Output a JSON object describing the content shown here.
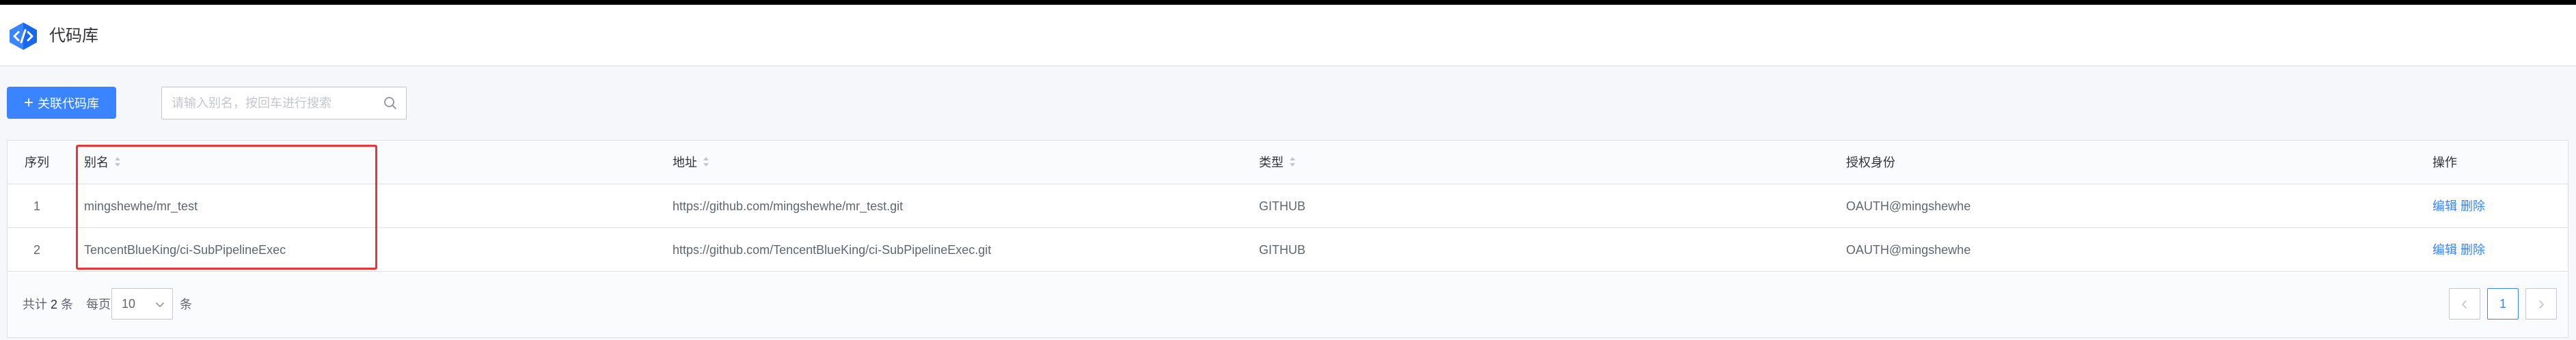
{
  "header": {
    "title": "代码库"
  },
  "toolbar": {
    "add_label": "关联代码库",
    "search_placeholder": "请输入别名，按回车进行搜索"
  },
  "table": {
    "columns": [
      "序列",
      "别名",
      "地址",
      "类型",
      "授权身份",
      "操作"
    ],
    "rows": [
      {
        "index": "1",
        "alias": "mingshewhe/mr_test",
        "url": "https://github.com/mingshewhe/mr_test.git",
        "type": "GITHUB",
        "auth": "OAUTH@mingshewhe",
        "edit": "编辑",
        "delete": "删除"
      },
      {
        "index": "2",
        "alias": "TencentBlueKing/ci-SubPipelineExec",
        "url": "https://github.com/TencentBlueKing/ci-SubPipelineExec.git",
        "type": "GITHUB",
        "auth": "OAUTH@mingshewhe",
        "edit": "编辑",
        "delete": "删除"
      }
    ]
  },
  "pagination": {
    "total_prefix": "共计",
    "total_count": "2",
    "total_suffix": "条",
    "per_page_label": "每页",
    "limit": "10",
    "per_page_unit": "条",
    "current_page": "1"
  },
  "colors": {
    "primary": "#3a84ff",
    "highlight": "#ea3636"
  }
}
